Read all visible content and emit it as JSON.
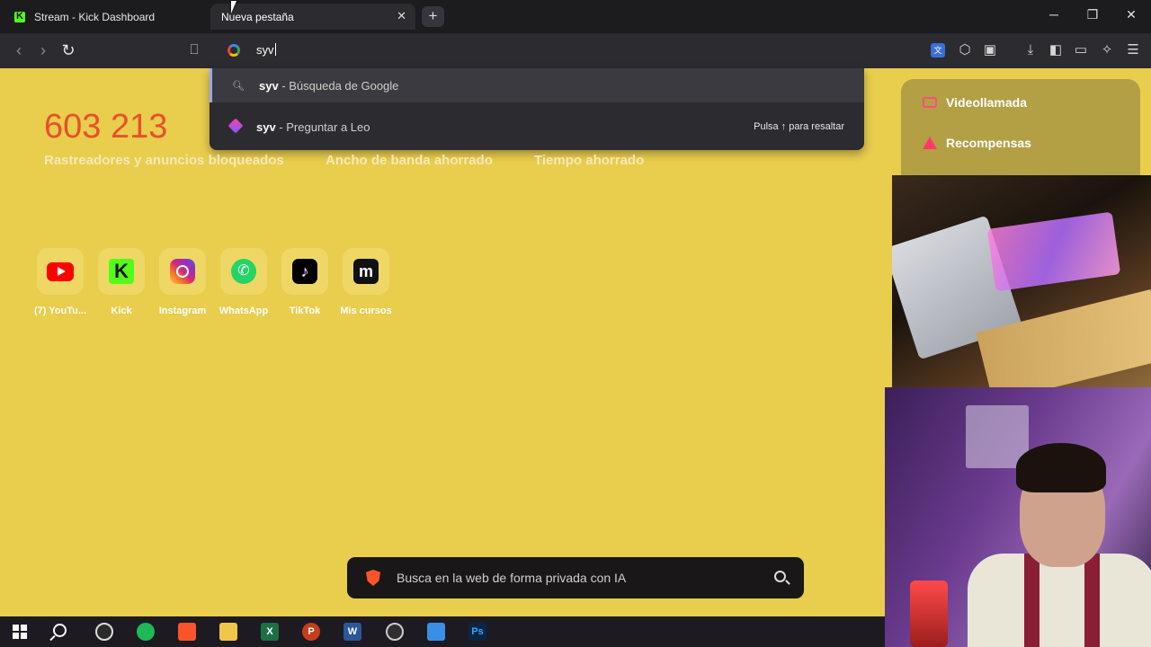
{
  "browser": {
    "tabs": [
      {
        "title": "Stream - Kick Dashboard",
        "active": false
      },
      {
        "title": "Nueva pestaña",
        "active": true
      }
    ],
    "new_tab": "+",
    "window_controls": {
      "minimize": "─",
      "restore": "❐",
      "close": "✕"
    }
  },
  "toolbar": {
    "back": "‹",
    "forward": "›",
    "reload": "↻",
    "bookmark": "🔖",
    "icons": [
      "translate-icon",
      "extensions-icon",
      "screenshot-icon",
      "download-icon",
      "sidebar-icon",
      "wallet-icon",
      "leo-ai-icon",
      "menu-icon"
    ]
  },
  "omnibox": {
    "value": "syv"
  },
  "suggestions": [
    {
      "query": "syv",
      "suffix": " - Búsqueda de Google",
      "icon": "search-icon",
      "selected": true
    },
    {
      "query": "syv",
      "suffix": " - Preguntar a Leo",
      "icon": "leo-icon",
      "hint": "Pulsa ↑ para resaltar",
      "selected": false
    }
  ],
  "stats": {
    "trackers_value": "603 213",
    "labels": [
      "Rastreadores y anuncios bloqueados",
      "Ancho de banda ahorrado",
      "Tiempo ahorrado"
    ]
  },
  "shortcuts": [
    {
      "label": "(7) YouTu...",
      "icon": "youtube-icon"
    },
    {
      "label": "Kick",
      "icon": "kick-icon"
    },
    {
      "label": "Instagram",
      "icon": "instagram-icon"
    },
    {
      "label": "WhatsApp",
      "icon": "whatsapp-icon"
    },
    {
      "label": "TikTok",
      "icon": "tiktok-icon"
    },
    {
      "label": "Mis cursos",
      "icon": "mis-cursos-icon"
    }
  ],
  "overlay": {
    "items": [
      "Videollamada",
      "Recompensas"
    ]
  },
  "search_box": {
    "placeholder": "Busca en la web de forma privada con IA"
  },
  "taskbar": {
    "apps": [
      "windows-start",
      "search",
      "chrome-extension-app",
      "spotify",
      "brave",
      "file-explorer",
      "excel",
      "powerpoint",
      "word",
      "obs",
      "vscode",
      "photoshop"
    ],
    "labels": {
      "excel": "X",
      "powerpoint": "P",
      "word": "W",
      "photoshop": "Ps"
    }
  },
  "colors": {
    "page_bg": "#e9cd4c",
    "stat_accent": "#e8502a",
    "kick_green": "#53fc18"
  }
}
